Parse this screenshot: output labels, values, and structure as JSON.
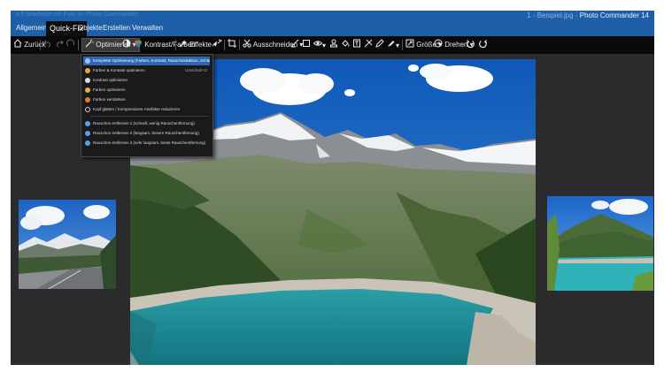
{
  "window": {
    "title_left": "Ich bearbeite ein Foto im Photo Commander",
    "title_prefix": "1 - Beispiel.jpg -",
    "app_name": "Photo Commander 14"
  },
  "menu": {
    "items": [
      "Allgemein",
      "Quick-Fix",
      "Objekte",
      "Erstellen",
      "Verwalten"
    ],
    "active": "Quick-Fix"
  },
  "toolbar": {
    "back_label": "Zurück",
    "optimize_label": "Optimieren",
    "contrast_label": "Kontrast/Farben",
    "effects_label": "Effekte",
    "cutout_label": "Ausschneiden",
    "size_label": "Größe",
    "rotate_label": "Drehen"
  },
  "dropdown": {
    "items": [
      {
        "label": "Komplette Optimierung (Farben, Kontrast, Rauschreduktion, Schärfe)",
        "shortcut": "",
        "icon": "magic-wand-icon",
        "color": "#9fc4ff",
        "highlighted": true
      },
      {
        "label": "Farben & Kontrast optimieren",
        "shortcut": "Umschalt+O",
        "icon": "color-icon",
        "color": "#e8a43a",
        "highlighted": false
      },
      {
        "label": "Kontrast optimieren",
        "shortcut": "",
        "icon": "contrast-icon",
        "color": "#dddddd",
        "highlighted": false
      },
      {
        "label": "Farben optimieren",
        "shortcut": "",
        "icon": "color-icon",
        "color": "#e0b040",
        "highlighted": false
      },
      {
        "label": "Farben verstärken",
        "shortcut": "",
        "icon": "color-icon",
        "color": "#e07a30",
        "highlighted": false
      },
      {
        "label": "Kopf glätten / Kompressions-Artefakte reduzieren",
        "shortcut": "",
        "icon": "smooth-icon",
        "color": "#cfcfcf",
        "highlighted": false
      },
      {
        "label": "Rauschen entfernen 1 (schnell, wenig Rauschentfernung)",
        "shortcut": "",
        "icon": "noise-icon",
        "color": "#5aa0e8",
        "highlighted": false
      },
      {
        "label": "Rauschen entfernen 2 (langsam, besere Rauschentfernung)",
        "shortcut": "",
        "icon": "noise-icon",
        "color": "#5aa0e8",
        "highlighted": false
      },
      {
        "label": "Rauschen entfernen 3 (sehr langsam, beste Rauschentfernung)",
        "shortcut": "",
        "icon": "noise-icon",
        "color": "#5aa0e8",
        "highlighted": false
      }
    ]
  },
  "colors": {
    "accent": "#1f5fa8",
    "toolbar_bg": "#0a0a0a",
    "canvas_bg": "#2b2b2d",
    "highlight": "#2e67b0"
  }
}
